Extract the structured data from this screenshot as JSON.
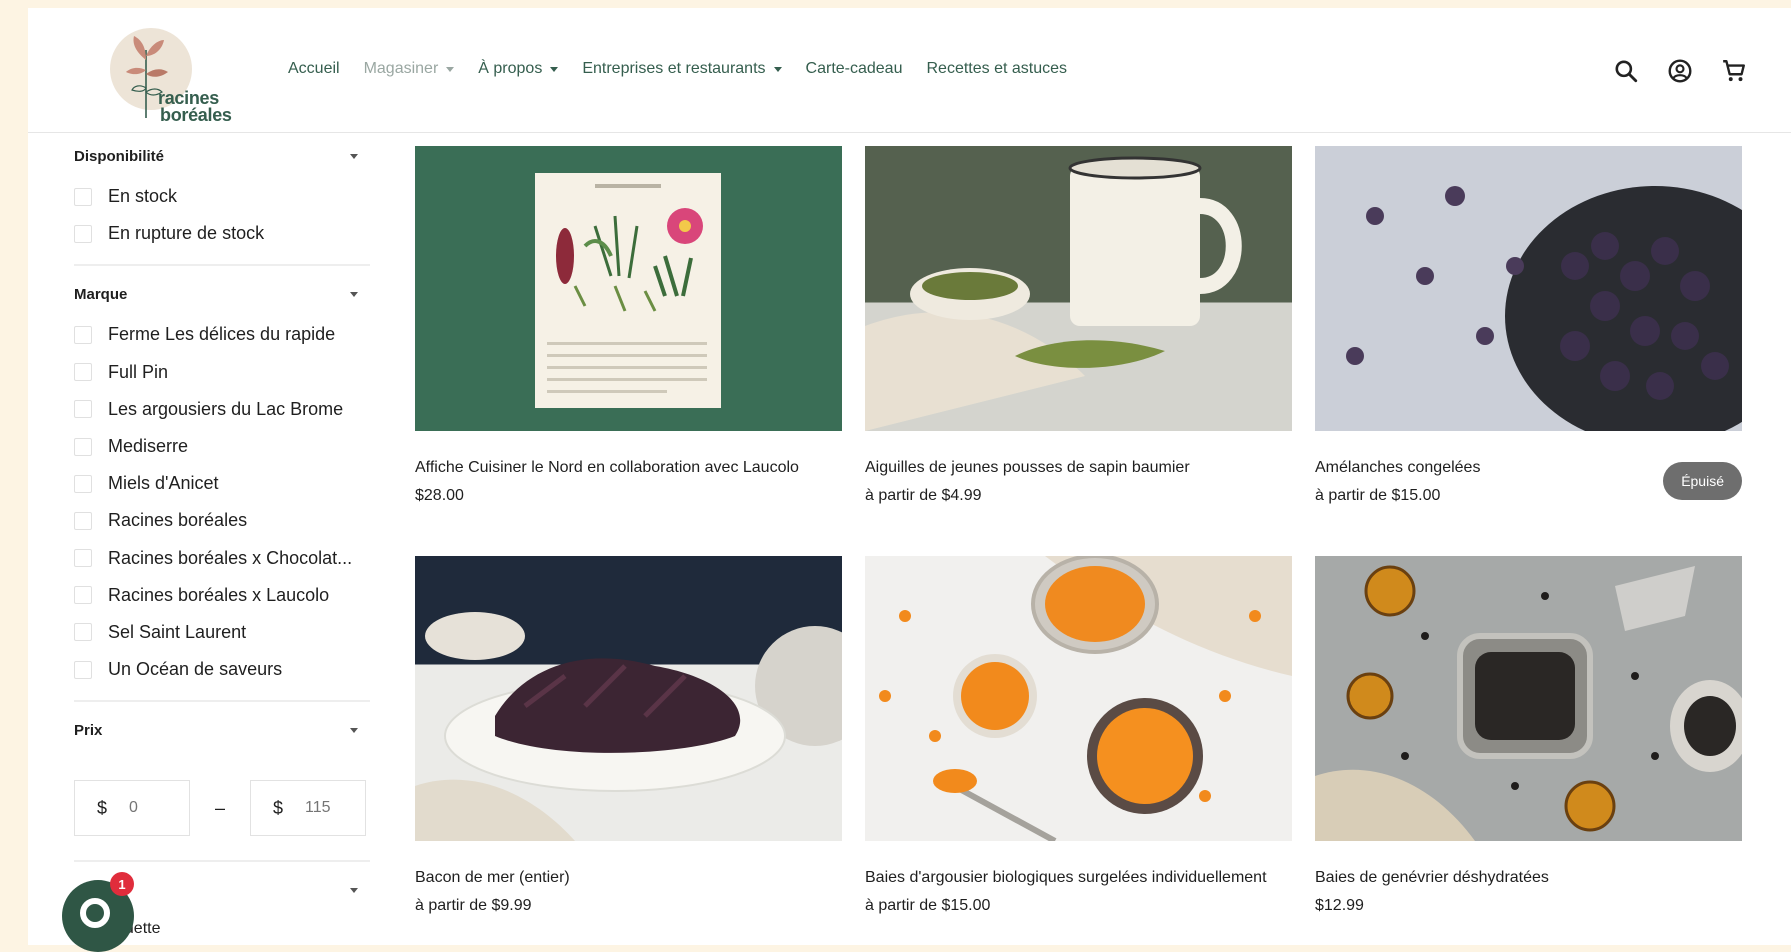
{
  "colors": {
    "brand": "#355e4e",
    "badge_bg": "#6e6e6e",
    "chat_bg": "#2f5645",
    "notif": "#e02d3c"
  },
  "brand": {
    "line1": "racines",
    "line2": "boréales"
  },
  "nav": [
    {
      "label": "Accueil",
      "dropdown": false,
      "muted": false
    },
    {
      "label": "Magasiner",
      "dropdown": true,
      "muted": true
    },
    {
      "label": "À propos",
      "dropdown": true,
      "muted": false
    },
    {
      "label": "Entreprises et restaurants",
      "dropdown": true,
      "muted": false
    },
    {
      "label": "Carte-cadeau",
      "dropdown": false,
      "muted": false
    },
    {
      "label": "Recettes et astuces",
      "dropdown": false,
      "muted": false
    }
  ],
  "header_icons": [
    "search-icon",
    "account-icon",
    "cart-icon"
  ],
  "filters": {
    "availability": {
      "title": "Disponibilité",
      "options": [
        "En stock",
        "En rupture de stock"
      ]
    },
    "brand": {
      "title": "Marque",
      "options": [
        "Ferme Les délices du rapide",
        "Full Pin",
        "Les argousiers du Lac Brome",
        "Mediserre",
        "Miels d'Anicet",
        "Racines boréales",
        "Racines boréales x Chocolat...",
        "Racines boréales x Laucolo",
        "Sel Saint Laurent",
        "Un Océan de saveurs"
      ]
    },
    "price": {
      "title": "Prix",
      "currency": "$",
      "min_placeholder": "0",
      "max_placeholder": "115",
      "dash": "–"
    },
    "sort": {
      "value": "vedette"
    }
  },
  "products": [
    {
      "title": "Affiche Cuisiner le Nord en collaboration avec Laucolo",
      "price": "$28.00",
      "badge": ""
    },
    {
      "title": "Aiguilles de jeunes pousses de sapin baumier",
      "price": "à partir de $4.99",
      "badge": ""
    },
    {
      "title": "Amélanches congelées",
      "price": "à partir de $15.00",
      "badge": "Épuisé"
    },
    {
      "title": "Bacon de mer (entier)",
      "price": "à partir de $9.99",
      "badge": ""
    },
    {
      "title": "Baies d'argousier biologiques surgelées individuellement",
      "price": "à partir de $15.00",
      "badge": ""
    },
    {
      "title": "Baies de genévrier déshydratées",
      "price": "$12.99",
      "badge": ""
    }
  ],
  "chat": {
    "notifications": "1"
  }
}
